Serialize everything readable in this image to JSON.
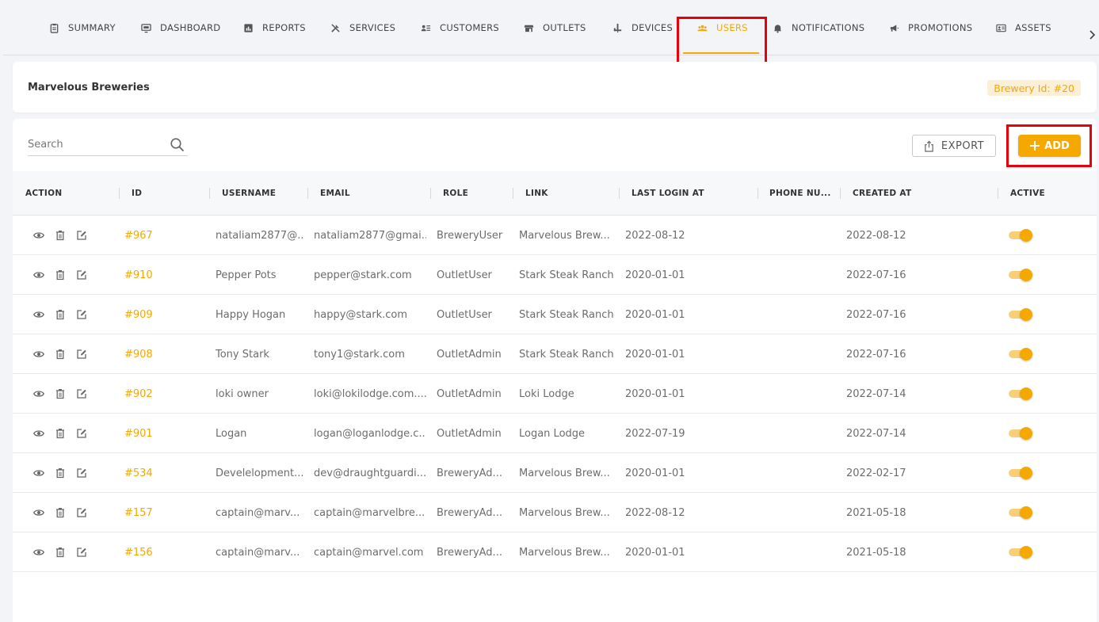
{
  "nav": {
    "tabs": [
      {
        "label": "SUMMARY",
        "icon": "clipboard-icon"
      },
      {
        "label": "DASHBOARD",
        "icon": "monitor-icon"
      },
      {
        "label": "REPORTS",
        "icon": "bar-chart-icon"
      },
      {
        "label": "SERVICES",
        "icon": "tools-icon"
      },
      {
        "label": "CUSTOMERS",
        "icon": "contacts-icon"
      },
      {
        "label": "OUTLETS",
        "icon": "store-icon"
      },
      {
        "label": "DEVICES",
        "icon": "tap-icon"
      },
      {
        "label": "USERS",
        "icon": "users-icon"
      },
      {
        "label": "NOTIFICATIONS",
        "icon": "bell-icon"
      },
      {
        "label": "PROMOTIONS",
        "icon": "megaphone-icon"
      },
      {
        "label": "ASSETS",
        "icon": "id-card-icon"
      }
    ],
    "active": "USERS"
  },
  "header": {
    "title": "Marvelous Breweries",
    "badge": "Brewery Id: #20"
  },
  "toolbar": {
    "search_placeholder": "Search",
    "export_label": "EXPORT",
    "add_label": "ADD"
  },
  "table": {
    "columns": [
      "ACTION",
      "ID",
      "USERNAME",
      "EMAIL",
      "ROLE",
      "LINK",
      "LAST LOGIN AT",
      "PHONE NU...",
      "CREATED AT",
      "ACTIVE"
    ],
    "rows": [
      {
        "id": "#967",
        "username": "nataliam2877@...",
        "email": "nataliam2877@gmai...",
        "role": "BreweryUser",
        "link": "Marvelous Brew...",
        "last_login": "2022-08-12",
        "phone": "",
        "created": "2022-08-12",
        "active": true
      },
      {
        "id": "#910",
        "username": "Pepper Pots",
        "email": "pepper@stark.com",
        "role": "OutletUser",
        "link": "Stark Steak Ranch",
        "last_login": "2020-01-01",
        "phone": "",
        "created": "2022-07-16",
        "active": true
      },
      {
        "id": "#909",
        "username": "Happy Hogan",
        "email": "happy@stark.com",
        "role": "OutletUser",
        "link": "Stark Steak Ranch",
        "last_login": "2020-01-01",
        "phone": "",
        "created": "2022-07-16",
        "active": true
      },
      {
        "id": "#908",
        "username": "Tony Stark",
        "email": "tony1@stark.com",
        "role": "OutletAdmin",
        "link": "Stark Steak Ranch",
        "last_login": "2020-01-01",
        "phone": "",
        "created": "2022-07-16",
        "active": true
      },
      {
        "id": "#902",
        "username": "loki owner",
        "email": "loki@lokilodge.com....",
        "role": "OutletAdmin",
        "link": "Loki Lodge",
        "last_login": "2020-01-01",
        "phone": "",
        "created": "2022-07-14",
        "active": true
      },
      {
        "id": "#901",
        "username": "Logan",
        "email": "logan@loganlodge.c...",
        "role": "OutletAdmin",
        "link": "Logan Lodge",
        "last_login": "2022-07-19",
        "phone": "",
        "created": "2022-07-14",
        "active": true
      },
      {
        "id": "#534",
        "username": "Develelopment...",
        "email": "dev@draughtguardi...",
        "role": "BreweryAd...",
        "link": "Marvelous Brew...",
        "last_login": "2020-01-01",
        "phone": "",
        "created": "2022-02-17",
        "active": true
      },
      {
        "id": "#157",
        "username": "captain@marv...",
        "email": "captain@marvelbre...",
        "role": "BreweryAd...",
        "link": "Marvelous Brew...",
        "last_login": "2022-08-12",
        "phone": "",
        "created": "2021-05-18",
        "active": true
      },
      {
        "id": "#156",
        "username": "captain@marv...",
        "email": "captain@marvel.com",
        "role": "BreweryAd...",
        "link": "Marvelous Brew...",
        "last_login": "2020-01-01",
        "phone": "",
        "created": "2021-05-18",
        "active": true
      }
    ]
  },
  "colors": {
    "accent": "#f5a800",
    "highlight_box": "#e8000b"
  }
}
